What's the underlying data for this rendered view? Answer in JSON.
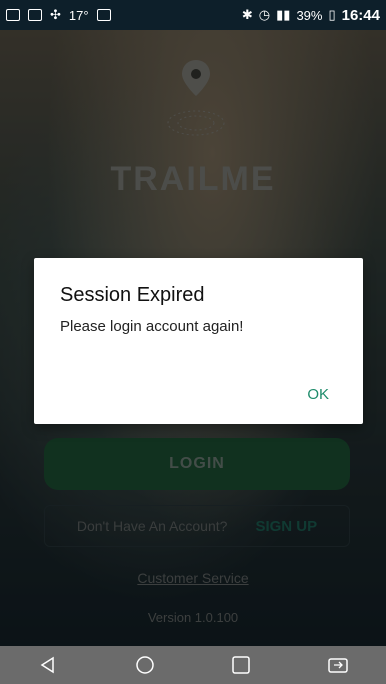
{
  "status_bar": {
    "temperature": "17°",
    "battery": "39%",
    "time": "16:44"
  },
  "app": {
    "brand_name": "TRAILME",
    "login_label": "LOGIN",
    "no_account_text": "Don't Have An Account?",
    "signup_label": "SIGN UP",
    "customer_service": "Customer Service",
    "version": "Version 1.0.100"
  },
  "dialog": {
    "title": "Session Expired",
    "message": "Please login account again!",
    "ok_label": "OK"
  },
  "colors": {
    "accent": "#1d8b6a",
    "login_button": "#1f5a3a"
  }
}
